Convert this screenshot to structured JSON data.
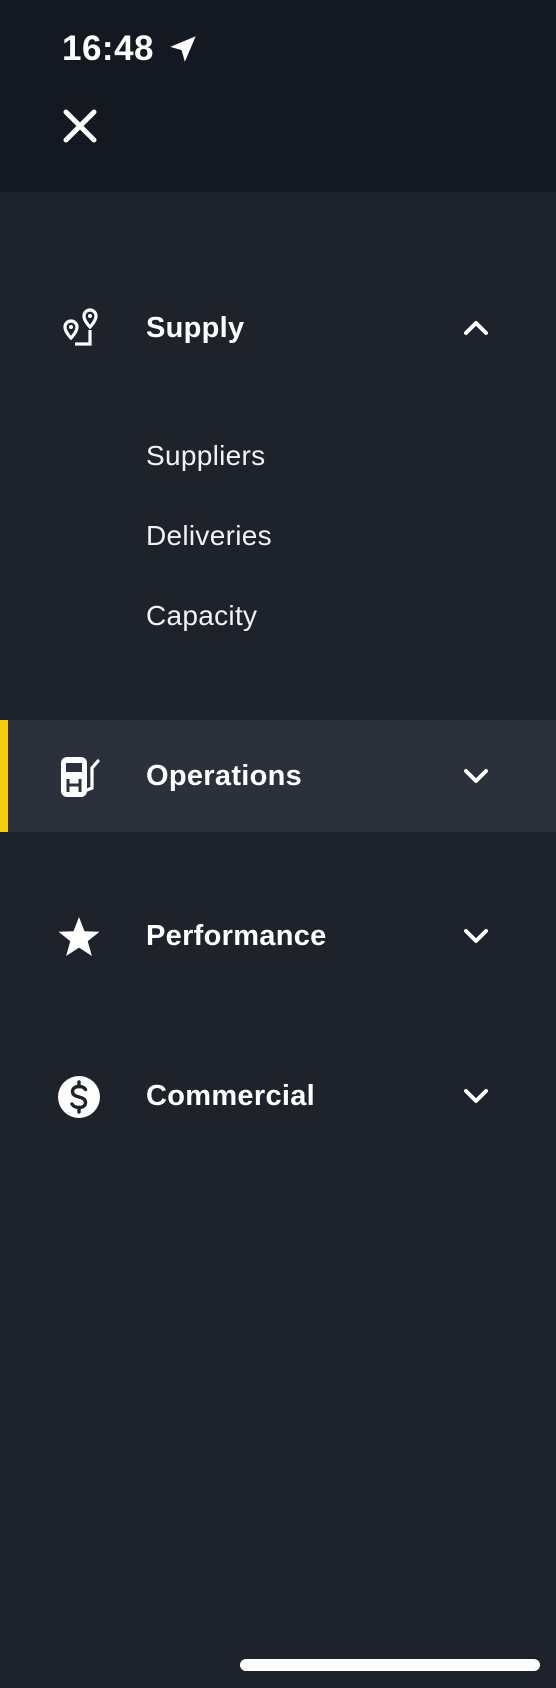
{
  "status_bar": {
    "time": "16:48",
    "location_icon": "location-arrow-icon"
  },
  "header": {
    "close_icon": "close-icon"
  },
  "menu": {
    "sections": [
      {
        "label": "Supply",
        "icon": "route-pins-icon",
        "expanded": true,
        "active": false,
        "items": [
          "Suppliers",
          "Deliveries",
          "Capacity"
        ]
      },
      {
        "label": "Operations",
        "icon": "fuel-pump-icon",
        "expanded": false,
        "active": true,
        "items": []
      },
      {
        "label": "Performance",
        "icon": "star-icon",
        "expanded": false,
        "active": false,
        "items": []
      },
      {
        "label": "Commercial",
        "icon": "dollar-circle-icon",
        "expanded": false,
        "active": false,
        "items": []
      }
    ]
  },
  "colors": {
    "background": "#1e232b",
    "topbar": "#141820",
    "active_row": "#2b313b",
    "accent": "#f5cc0a",
    "text": "#ffffff"
  }
}
